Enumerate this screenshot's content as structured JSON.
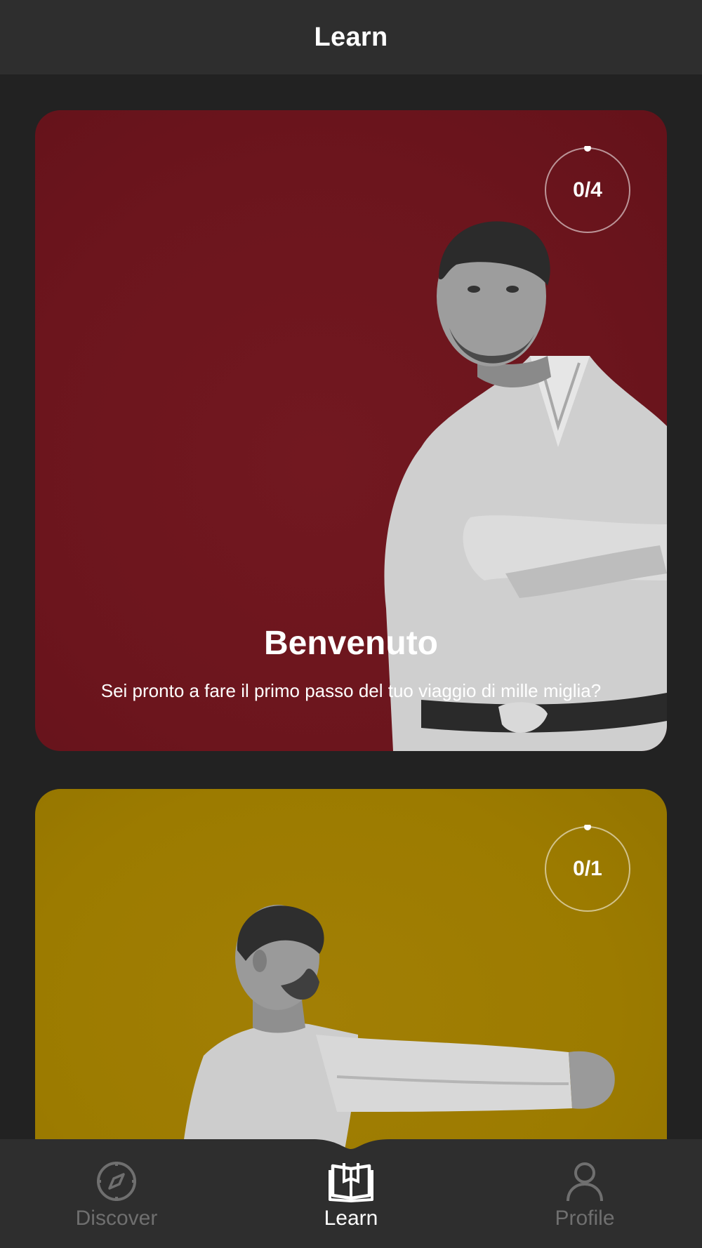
{
  "header": {
    "title": "Learn"
  },
  "cards": [
    {
      "title": "Benvenuto",
      "subtitle": "Sei pronto a fare il primo passo del tuo viaggio di mille miglia?",
      "progress": "0/4",
      "background_color": "#6c151d",
      "image": "karate-instructor-arms-crossed"
    },
    {
      "progress": "0/1",
      "background_color": "#9c7b00",
      "image": "karate-punch-side-view"
    }
  ],
  "bottom_nav": {
    "items": [
      {
        "label": "Discover",
        "icon": "compass-icon",
        "active": false
      },
      {
        "label": "Learn",
        "icon": "open-book-icon",
        "active": true
      },
      {
        "label": "Profile",
        "icon": "person-icon",
        "active": false
      }
    ]
  },
  "colors": {
    "background": "#222222",
    "bar": "#2e2e2e",
    "inactive": "#6f6f6f",
    "active": "#ffffff"
  }
}
